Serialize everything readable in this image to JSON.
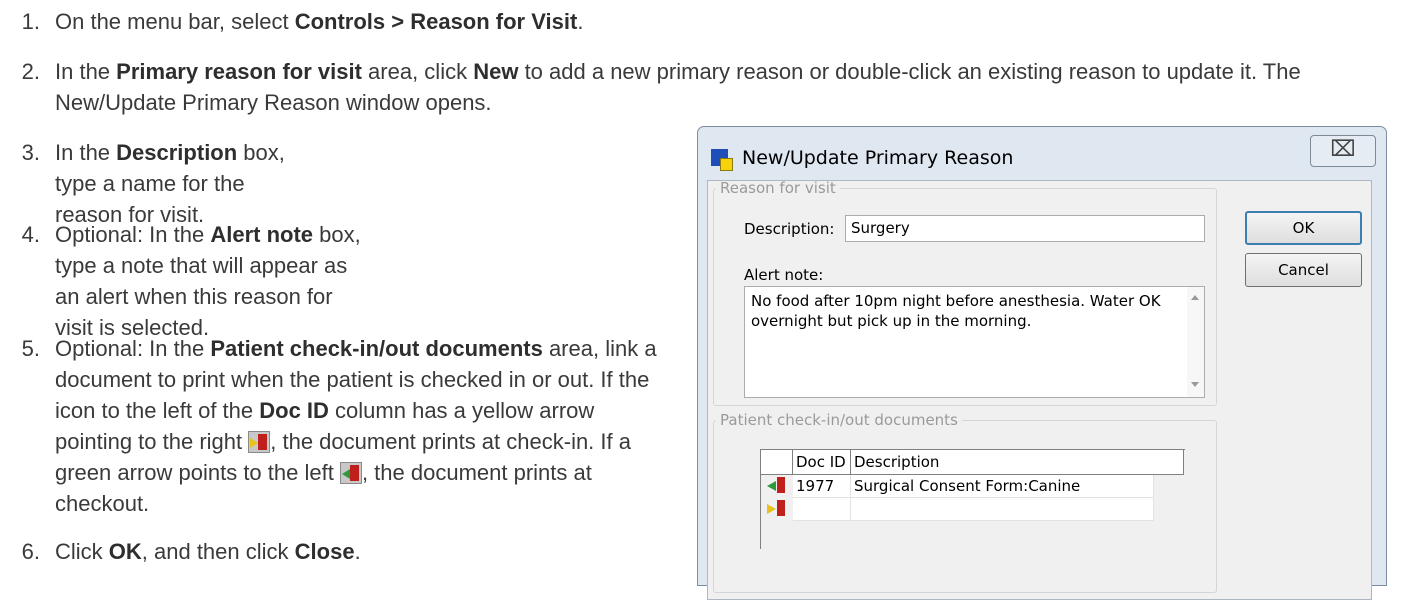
{
  "steps": [
    {
      "num": "1.",
      "parts": [
        {
          "t": "On the menu bar, select "
        },
        {
          "t": "Controls > Reason for Visit",
          "b": true
        },
        {
          "t": "."
        }
      ]
    },
    {
      "num": "2.",
      "parts": [
        {
          "t": "In the "
        },
        {
          "t": "Primary reason for visit",
          "b": true
        },
        {
          "t": " area, click "
        },
        {
          "t": "New",
          "b": true
        },
        {
          "t": " to add a new primary reason or double-click an existing reason to update it. The New/Update Primary Reason window opens."
        }
      ]
    },
    {
      "num": "3.",
      "parts": [
        {
          "t": "In the "
        },
        {
          "t": "Description",
          "b": true
        },
        {
          "t": " box, type a name for the reason for visit."
        }
      ]
    },
    {
      "num": "4.",
      "parts": [
        {
          "t": "Optional: In the "
        },
        {
          "t": "Alert note",
          "b": true
        },
        {
          "t": " box, type a note that will appear as an alert when this reason for visit is selected."
        }
      ]
    },
    {
      "num": "5.",
      "parts": [
        {
          "t": "Optional: In the "
        },
        {
          "t": "Patient check-in/out documents",
          "b": true
        },
        {
          "t": " area, link a document to print when the patient is checked in or out. If the icon to the left of the "
        },
        {
          "t": "Doc ID",
          "b": true
        },
        {
          "t": " column has a yellow arrow pointing to the right "
        },
        {
          "icon": "checkin-icon"
        },
        {
          "t": ", the document prints at check-in. If a green arrow points to the left "
        },
        {
          "icon": "checkout-icon"
        },
        {
          "t": ", the document prints at checkout."
        }
      ]
    },
    {
      "num": "6.",
      "parts": [
        {
          "t": "Click "
        },
        {
          "t": "OK",
          "b": true
        },
        {
          "t": ", and then click "
        },
        {
          "t": "Close",
          "b": true
        },
        {
          "t": "."
        }
      ]
    }
  ],
  "dialog": {
    "title": "New/Update Primary Reason",
    "close_glyph": "⌧",
    "reason_group": "Reason for visit",
    "description_label": "Description:",
    "description_value": "Surgery",
    "alert_label": "Alert note:",
    "alert_value": "No food after 10pm night before anesthesia. Water OK overnight but pick up in the morning.",
    "ok_label": "OK",
    "cancel_label": "Cancel",
    "docs_group": "Patient check-in/out documents",
    "grid": {
      "columns": [
        "Doc ID",
        "Description"
      ],
      "rows": [
        {
          "icon": "checkout-icon",
          "doc_id": "1977",
          "description": "Surgical Consent Form:Canine"
        },
        {
          "icon": "checkin-icon",
          "doc_id": "",
          "description": ""
        }
      ]
    }
  },
  "colors": {
    "checkin_arrow": "#e8c21a",
    "checkout_arrow": "#2f9a3a",
    "door": "#c0201c",
    "app_blue": "#1e4fb8"
  }
}
